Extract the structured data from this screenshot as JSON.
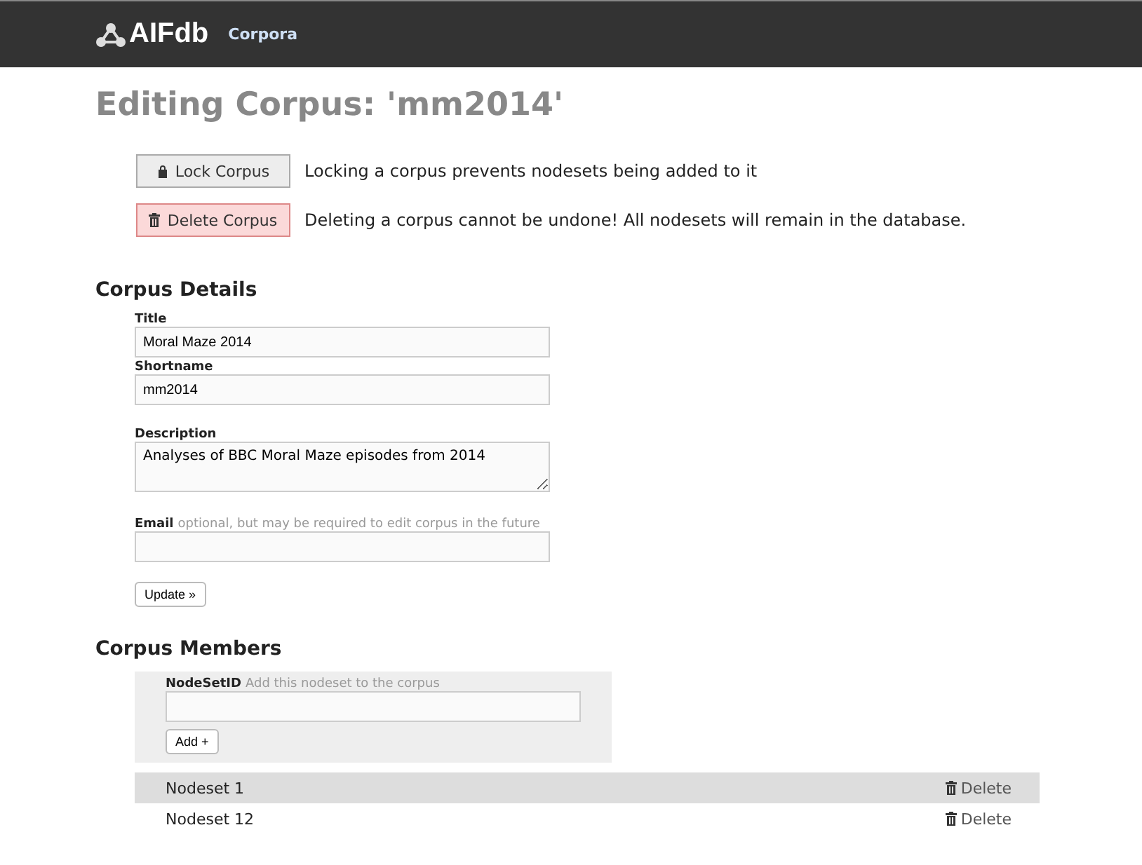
{
  "navbar": {
    "brand": "AIFdb",
    "link": "Corpora"
  },
  "heading": "Editing Corpus: 'mm2014'",
  "actions": [
    {
      "kind": "lock",
      "label": "Lock Corpus",
      "note": "Locking a corpus prevents nodesets being added to it"
    },
    {
      "kind": "delete",
      "label": "Delete Corpus",
      "note": "Deleting a corpus cannot be undone! All nodesets will remain in the database."
    }
  ],
  "details": {
    "title": "Corpus Details",
    "fields": [
      {
        "kind": "input",
        "label": "Title",
        "value": "Moral Maze 2014"
      },
      {
        "kind": "input",
        "label": "Shortname",
        "value": "mm2014"
      },
      {
        "kind": "textarea",
        "label": "Description",
        "value": "Analyses of BBC Moral Maze episodes from 2014"
      },
      {
        "kind": "input",
        "label": "Email",
        "hint": "optional, but may be required to edit corpus in the future"
      }
    ],
    "button": "Update »"
  },
  "members": {
    "title": "Corpus Members",
    "field_label": "NodeSetID",
    "field_hint": "Add this nodeset to the corpus",
    "button": "Add +",
    "rows": [
      {
        "name": "Nodeset 1",
        "action": "Delete"
      },
      {
        "name": "Nodeset 12",
        "action": "Delete"
      }
    ]
  }
}
